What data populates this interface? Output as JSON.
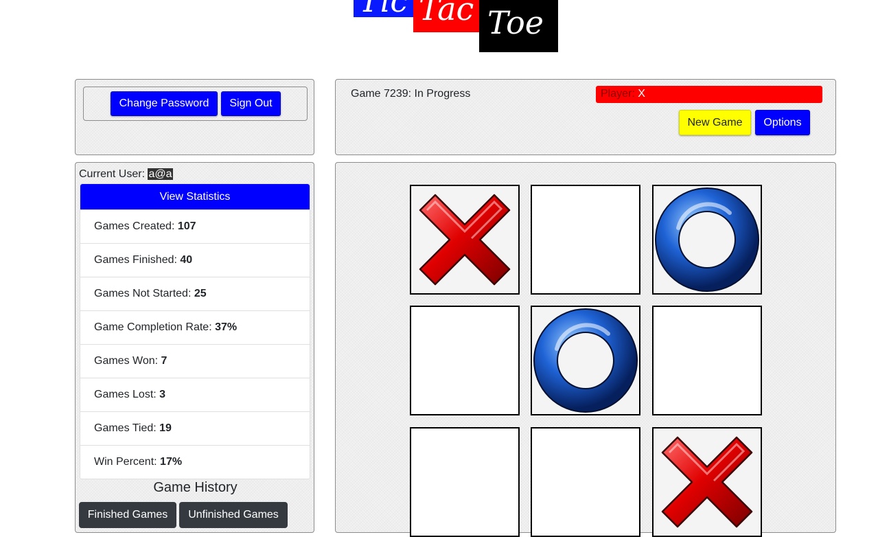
{
  "logo": {
    "word1": "Tic",
    "word2": "Tac",
    "word3": "Toe",
    "colors": {
      "tic": "#0a1aff",
      "tac": "#ff0000",
      "toe": "#000000"
    }
  },
  "account": {
    "change_password_label": "Change Password",
    "sign_out_label": "Sign Out"
  },
  "game": {
    "status": "Game 7239: In Progress",
    "player_label": "Player:",
    "player_value": "X",
    "new_game_label": "New Game",
    "options_label": "Options"
  },
  "user": {
    "label": "Current User:",
    "name": "a@a"
  },
  "stats": {
    "view_label": "View Statistics",
    "rows": [
      {
        "label": "Games Created:",
        "value": "107"
      },
      {
        "label": "Games Finished:",
        "value": "40"
      },
      {
        "label": "Games Not Started:",
        "value": "25"
      },
      {
        "label": "Game Completion Rate:",
        "value": "37%"
      },
      {
        "label": "Games Won:",
        "value": "7"
      },
      {
        "label": "Games Lost:",
        "value": "3"
      },
      {
        "label": "Games Tied:",
        "value": "19"
      },
      {
        "label": "Win Percent:",
        "value": "17%"
      }
    ]
  },
  "history": {
    "title": "Game History",
    "finished_label": "Finished Games",
    "unfinished_label": "Unfinished Games"
  },
  "board": {
    "cells": [
      "x",
      "",
      "o",
      "",
      "o",
      "",
      "",
      "",
      "x"
    ]
  },
  "colors": {
    "primary": "#0000ff",
    "warning": "#ffff00",
    "danger": "#ff0000",
    "dark": "#343a40"
  }
}
